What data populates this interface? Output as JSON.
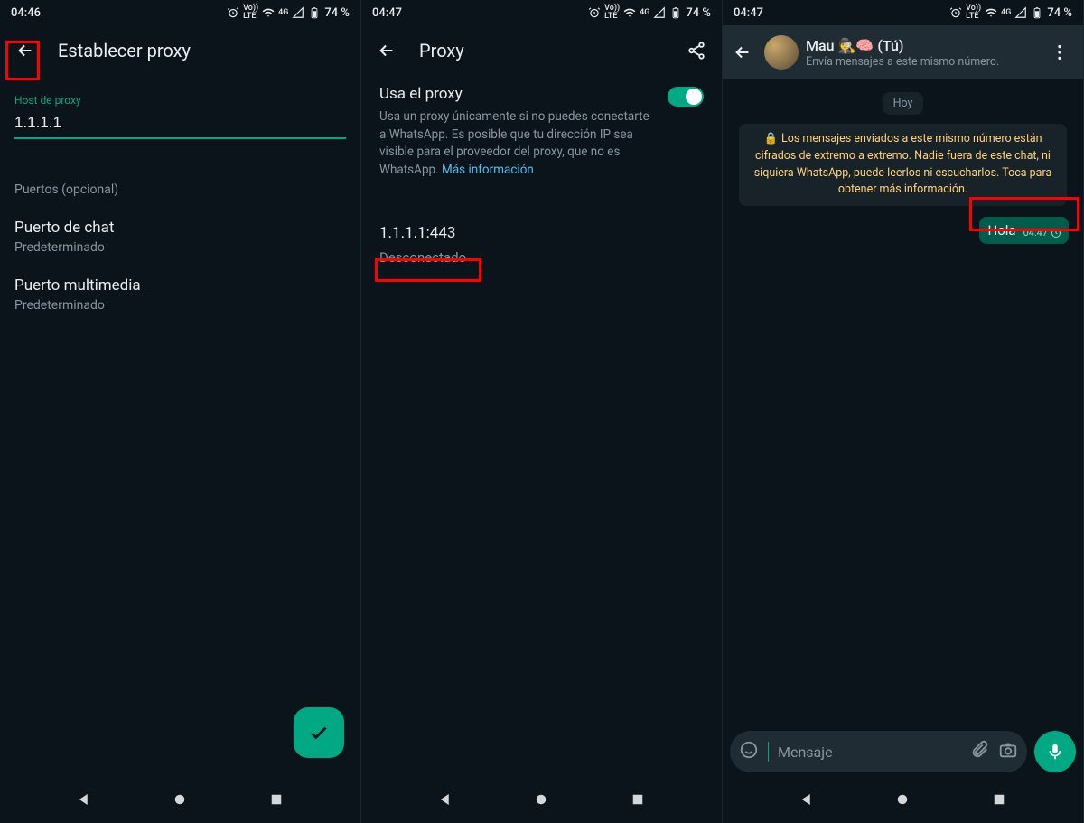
{
  "colors": {
    "accent": "#00a884",
    "highlight": "#ff0000",
    "link": "#53bdeb"
  },
  "screen1": {
    "status": {
      "time": "04:46",
      "battery": "74 %",
      "net": "4G",
      "volte": "Vo))\nLTE"
    },
    "title": "Establecer proxy",
    "host_label": "Host de proxy",
    "host_value": "1.1.1.1",
    "ports_section": "Puertos (opcional)",
    "chat_port": {
      "title": "Puerto de chat",
      "sub": "Predeterminado"
    },
    "media_port": {
      "title": "Puerto multimedia",
      "sub": "Predeterminado"
    }
  },
  "screen2": {
    "status": {
      "time": "04:47",
      "battery": "74 %",
      "net": "4G"
    },
    "title": "Proxy",
    "toggle": {
      "title": "Usa el proxy",
      "desc": "Usa un proxy únicamente si no puedes conectarte a WhatsApp. Es posible que tu dirección IP sea visible para el proveedor del proxy, que no es WhatsApp. ",
      "link": "Más información"
    },
    "proxy_host": "1.1.1.1:443",
    "proxy_status": "Desconectado"
  },
  "screen3": {
    "status": {
      "time": "04:47",
      "battery": "74 %",
      "net": "4G"
    },
    "contact": {
      "name": "Mau 🕵️🧠 (Tú)",
      "sub": "Envía mensajes a este mismo número."
    },
    "date_chip": "Hoy",
    "encryption_banner": "Los mensajes enviados a este mismo número están cifrados de extremo a extremo. Nadie fuera de este chat, ni siquiera WhatsApp, puede leerlos ni escucharlos. Toca para obtener más información.",
    "message": {
      "text": "Hola",
      "time": "04:47"
    },
    "input_placeholder": "Mensaje"
  }
}
